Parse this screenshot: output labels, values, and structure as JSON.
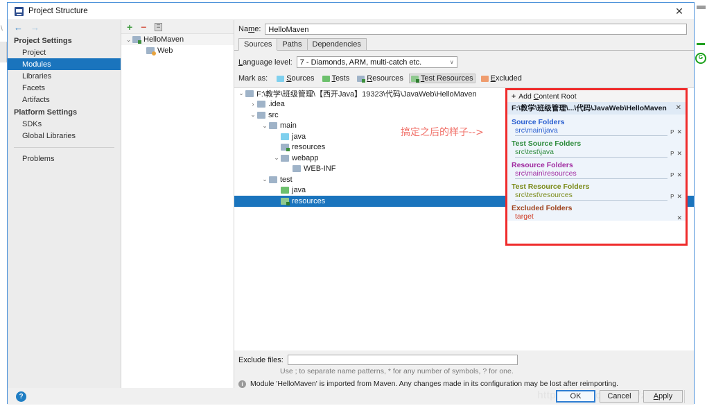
{
  "window": {
    "title": "Project Structure",
    "app_icon": "intellij-idea-icon",
    "close_label": "✕"
  },
  "sidebar": {
    "nav_back": "←",
    "nav_forward": "→",
    "groups": [
      {
        "label": "Project Settings",
        "items": [
          {
            "label": "Project",
            "selected": false
          },
          {
            "label": "Modules",
            "selected": true
          },
          {
            "label": "Libraries",
            "selected": false
          },
          {
            "label": "Facets",
            "selected": false
          },
          {
            "label": "Artifacts",
            "selected": false
          }
        ]
      },
      {
        "label": "Platform Settings",
        "items": [
          {
            "label": "SDKs",
            "selected": false
          },
          {
            "label": "Global Libraries",
            "selected": false
          }
        ]
      }
    ],
    "problems_label": "Problems"
  },
  "module_list": {
    "toolbar": {
      "add": "+",
      "remove": "−",
      "copy": "copy-icon"
    },
    "items": [
      {
        "label": "HelloMaven",
        "twisty": "⌄",
        "icon": "module-folder-icon",
        "indent": 0,
        "selected": false
      },
      {
        "label": "Web",
        "twisty": "",
        "icon": "web-facet-icon",
        "indent": 1,
        "selected": false
      }
    ]
  },
  "content": {
    "name_label_pre": "Na",
    "name_label_accel": "m",
    "name_label_post": "e:",
    "name_value": "HelloMaven",
    "tabs": [
      {
        "label": "Sources",
        "active": true
      },
      {
        "label": "Paths",
        "active": false
      },
      {
        "label": "Dependencies",
        "active": false
      }
    ],
    "language_level": {
      "label_pre": "L",
      "label_accel": "a",
      "label_post": "nguage level:",
      "value": "7 - Diamonds, ARM, multi-catch etc.",
      "caret": "∨"
    },
    "mark_as": {
      "label": "Mark as:",
      "options": [
        {
          "label": "Sources",
          "accel": "S",
          "rest": "ources",
          "swatch": "blue",
          "selected": false
        },
        {
          "label": "Tests",
          "accel": "T",
          "rest": "ests",
          "swatch": "green",
          "selected": false
        },
        {
          "label": "Resources",
          "accel": "R",
          "rest": "esources",
          "swatch": "res",
          "selected": false
        },
        {
          "label": "Test Resources",
          "accel": "T",
          "rest": "est Resources",
          "swatch": "tres",
          "selected": true
        },
        {
          "label": "Excluded",
          "accel": "E",
          "rest": "xcluded",
          "swatch": "orange",
          "selected": false
        }
      ]
    },
    "tree": [
      {
        "label": "F:\\教学\\班级管理\\【西开Java】19323\\代码\\JavaWeb\\HelloMaven",
        "indent": 0,
        "twisty": "⌄",
        "icon": "grey",
        "selected": false
      },
      {
        "label": ".idea",
        "indent": 1,
        "twisty": "›",
        "icon": "grey",
        "selected": false
      },
      {
        "label": "src",
        "indent": 1,
        "twisty": "⌄",
        "icon": "grey",
        "selected": false
      },
      {
        "label": "main",
        "indent": 2,
        "twisty": "⌄",
        "icon": "grey",
        "selected": false
      },
      {
        "label": "java",
        "indent": 3,
        "twisty": "",
        "icon": "blue",
        "selected": false
      },
      {
        "label": "resources",
        "indent": 3,
        "twisty": "",
        "icon": "res",
        "selected": false
      },
      {
        "label": "webapp",
        "indent": 3,
        "twisty": "⌄",
        "icon": "grey",
        "selected": false
      },
      {
        "label": "WEB-INF",
        "indent": 4,
        "twisty": "",
        "icon": "grey",
        "selected": false
      },
      {
        "label": "test",
        "indent": 2,
        "twisty": "⌄",
        "icon": "grey",
        "selected": false
      },
      {
        "label": "java",
        "indent": 3,
        "twisty": "",
        "icon": "green",
        "selected": false
      },
      {
        "label": "resources",
        "indent": 3,
        "twisty": "",
        "icon": "tres",
        "selected": true
      }
    ],
    "annotation": "搞定之后的样子-->",
    "detail": {
      "add_content_root_pre": "Add ",
      "add_content_root_accel": "C",
      "add_content_root_post": "ontent Root",
      "plus": "+",
      "root_path": "F:\\教学\\班级管理\\...\\代码\\JavaWeb\\HelloMaven",
      "root_close": "✕",
      "groups": [
        {
          "title": "Source Folders",
          "kind": "src",
          "entries": [
            {
              "path": "src\\main\\java",
              "has_prefix_icon": true,
              "prefix_icon": "P",
              "close": "✕"
            }
          ]
        },
        {
          "title": "Test Source Folders",
          "kind": "tsrc",
          "entries": [
            {
              "path": "src\\test\\java",
              "has_prefix_icon": true,
              "prefix_icon": "P",
              "close": "✕"
            }
          ]
        },
        {
          "title": "Resource Folders",
          "kind": "rsrc",
          "entries": [
            {
              "path": "src\\main\\resources",
              "has_prefix_icon": true,
              "prefix_icon": "P",
              "close": "✕"
            }
          ]
        },
        {
          "title": "Test Resource Folders",
          "kind": "trsrc",
          "entries": [
            {
              "path": "src\\test\\resources",
              "has_prefix_icon": true,
              "prefix_icon": "P",
              "close": "✕"
            }
          ]
        },
        {
          "title": "Excluded Folders",
          "kind": "excl",
          "entries": [
            {
              "path": "target",
              "has_prefix_icon": false,
              "prefix_icon": "",
              "close": "✕"
            }
          ]
        }
      ],
      "highlight_color": "#ef2b2b"
    },
    "exclude_files": {
      "label": "Exclude files:",
      "value": "",
      "hint": "Use ; to separate name patterns, * for any number of symbols, ? for one."
    },
    "status_message": "Module 'HelloMaven' is imported from Maven. Any changes made in its configuration may be lost after reimporting."
  },
  "footer": {
    "help_label": "?",
    "buttons": [
      {
        "label": "OK",
        "accel": "",
        "rest": "OK",
        "default": true
      },
      {
        "label": "Cancel",
        "accel": "",
        "rest": "Cancel",
        "default": false
      },
      {
        "label": "Apply",
        "accel": "A",
        "rest": "pply",
        "default": false
      }
    ],
    "watermark": "https://blog.csdn.net/zupti_rl"
  },
  "background": {
    "left_char": "\\",
    "globe_icon": "globe-icon"
  }
}
